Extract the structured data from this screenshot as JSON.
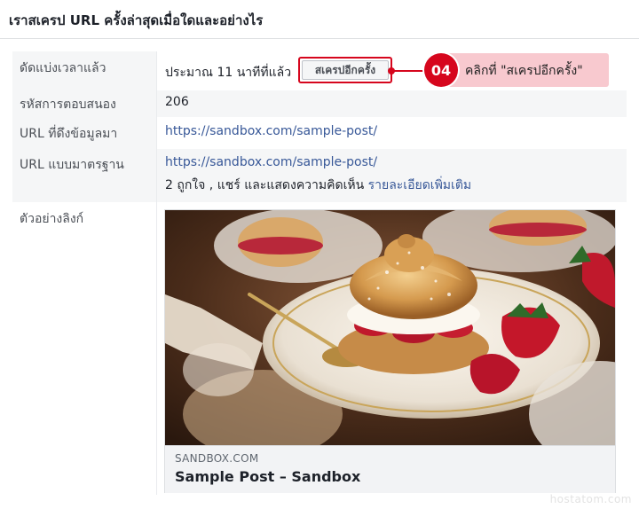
{
  "header": {
    "title": "เราสเครป URL ครั้งล่าสุดเมื่อใดและอย่างไร"
  },
  "rows": {
    "fetched": {
      "label": "ดัดแบ่งเวลาแล้ว",
      "value": "ประมาณ 11 นาทีที่แล้ว",
      "button_label": "สเครปอีกครั้ง"
    },
    "response": {
      "label": "รหัสการตอบสนอง",
      "value": "206"
    },
    "fetched_url": {
      "label": "URL ที่ดึงข้อมูลมา",
      "value": "https://sandbox.com/sample-post/"
    },
    "canonical": {
      "label": "URL แบบมาตรฐาน",
      "value": "https://sandbox.com/sample-post/",
      "stats": "2 ถูกใจ , แชร์ และแสดงความคิดเห็น",
      "more_link": "รายละเอียดเพิ่มเติม"
    },
    "preview": {
      "label": "ตัวอย่างลิงก์"
    }
  },
  "callout": {
    "step": "04",
    "text": "คลิกที่ \"สเครปอีกครั้ง\""
  },
  "card": {
    "domain": "SANDBOX.COM",
    "title": "Sample Post – Sandbox"
  },
  "watermark": "hostatom.com",
  "colors": {
    "accent": "#d6061d",
    "link": "#385898",
    "callout_bg": "#f8c9cf"
  }
}
